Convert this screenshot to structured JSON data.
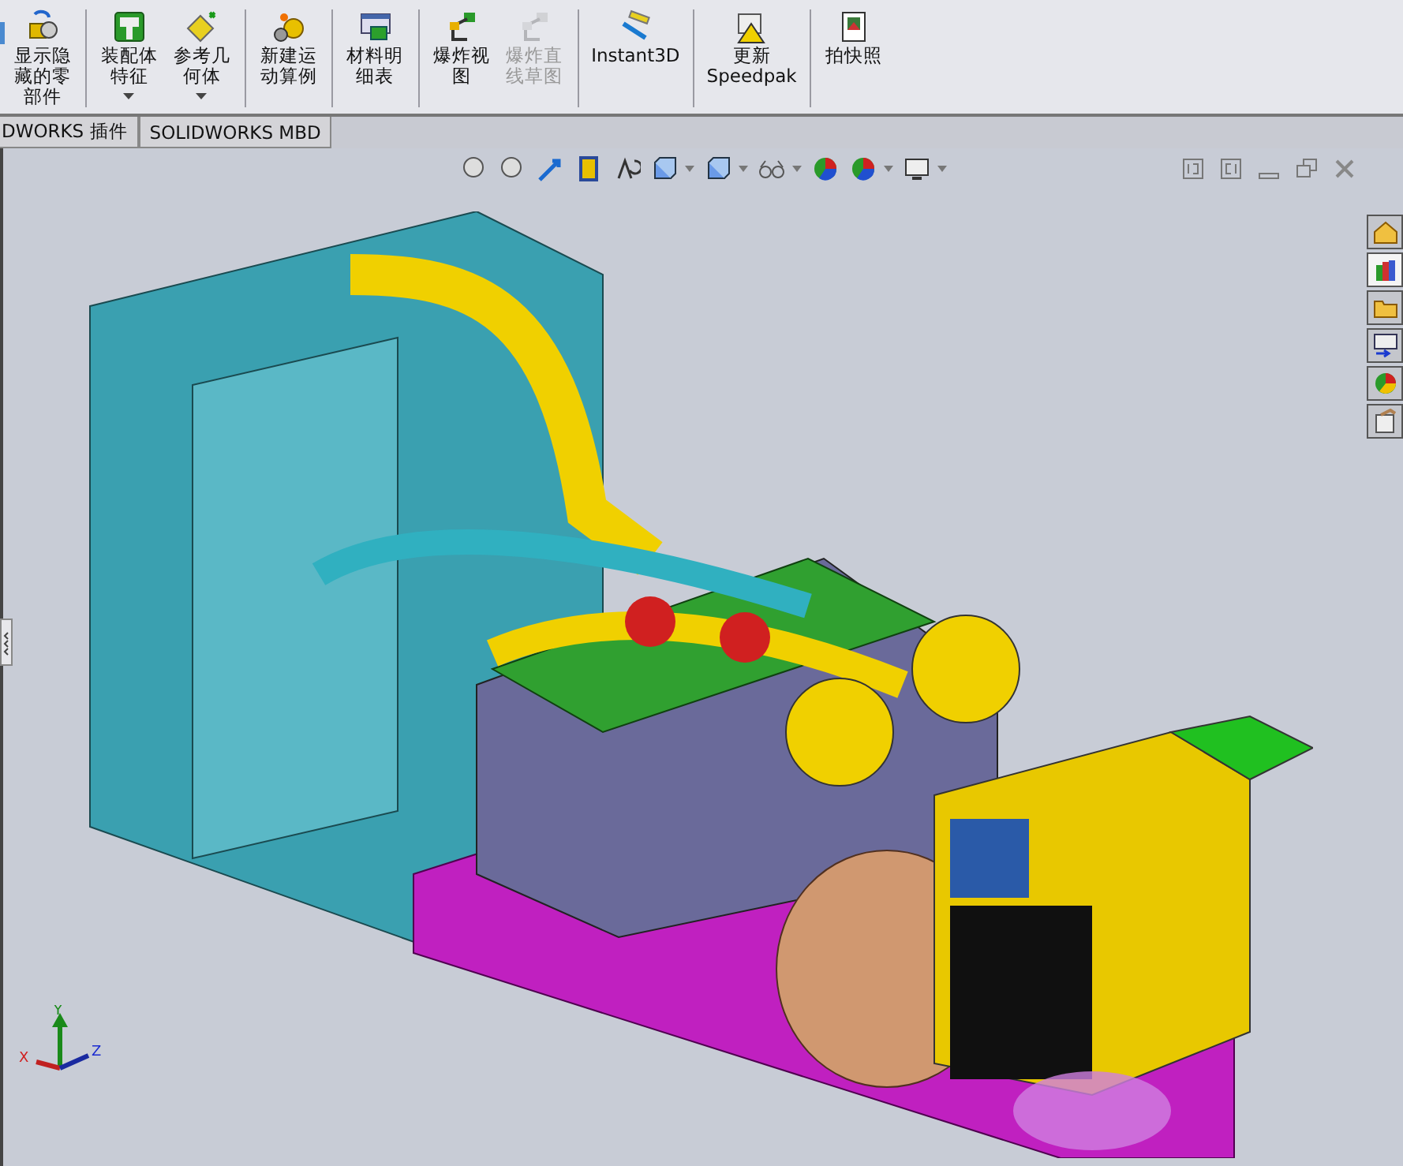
{
  "toolbar": {
    "buttons": [
      {
        "label": "显示隐藏的零部件",
        "dropdown": false,
        "disabled": false
      },
      {
        "label": "装配体特征",
        "dropdown": true,
        "disabled": false
      },
      {
        "label": "参考几何体",
        "dropdown": true,
        "disabled": false
      },
      {
        "label": "新建运动算例",
        "dropdown": false,
        "disabled": false
      },
      {
        "label": "材料明细表",
        "dropdown": false,
        "disabled": false
      },
      {
        "label": "爆炸视图",
        "dropdown": false,
        "disabled": false
      },
      {
        "label": "爆炸直线草图",
        "dropdown": false,
        "disabled": true
      },
      {
        "label": "Instant3D",
        "dropdown": false,
        "disabled": false
      },
      {
        "label": "更新 Speedpak",
        "dropdown": false,
        "disabled": false
      },
      {
        "label": "拍快照",
        "dropdown": false,
        "disabled": false
      }
    ]
  },
  "tabs": [
    {
      "label": "DWORKS 插件"
    },
    {
      "label": "SOLIDWORKS MBD"
    }
  ],
  "task_pane": {
    "tabs": [
      {
        "selected": false
      },
      {
        "selected": true
      },
      {
        "selected": false
      },
      {
        "selected": false
      },
      {
        "selected": false
      },
      {
        "selected": false
      }
    ]
  },
  "triad": {
    "x": "X",
    "y": "Y",
    "z": "Z"
  }
}
